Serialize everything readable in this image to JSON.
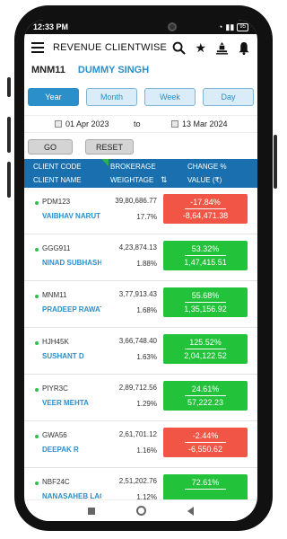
{
  "status_bar": {
    "time": "12:33 PM",
    "battery": "95"
  },
  "app_bar": {
    "title": "REVENUE CLIENTWISE"
  },
  "user": {
    "code": "MNM11",
    "name": "DUMMY SINGH"
  },
  "period_tabs": [
    {
      "label": "Year",
      "active": true
    },
    {
      "label": "Month",
      "active": false
    },
    {
      "label": "Week",
      "active": false
    },
    {
      "label": "Day",
      "active": false
    }
  ],
  "dates": {
    "from": "01 Apr 2023",
    "to_label": "to",
    "to": "13 Mar 2024"
  },
  "buttons": {
    "go": "GO",
    "reset": "RESET"
  },
  "table_header": {
    "client_code": "CLIENT CODE",
    "client_name": "CLIENT NAME",
    "brokerage": "BROKERAGE",
    "weightage": "WEIGHTAGE",
    "sort_icon": "⇅",
    "change_pct": "CHANGE %",
    "value": "VALUE (₹)"
  },
  "rows": [
    {
      "code": "PDM123",
      "name": "VAIBHAV NARUT",
      "brokerage": "39,80,686.77",
      "weightage": "17.7%",
      "change": "-17.84%",
      "value": "-8,64,471.38",
      "trend": "down"
    },
    {
      "code": "GGG911",
      "name": "NINAD SUBHASH AT",
      "brokerage": "4,23,874.13",
      "weightage": "1.88%",
      "change": "53.32%",
      "value": "1,47,415.51",
      "trend": "up"
    },
    {
      "code": "MNM11",
      "name": "PRADEEP RAWAT",
      "brokerage": "3,77,913.43",
      "weightage": "1.68%",
      "change": "55.68%",
      "value": "1,35,156.92",
      "trend": "up"
    },
    {
      "code": "HJH45K",
      "name": "SUSHANT D",
      "brokerage": "3,66,748.40",
      "weightage": "1.63%",
      "change": "125.52%",
      "value": "2,04,122.52",
      "trend": "up"
    },
    {
      "code": "PIYR3C",
      "name": "VEER MEHTA",
      "brokerage": "2,89,712.56",
      "weightage": "1.29%",
      "change": "24.61%",
      "value": "57,222.23",
      "trend": "up"
    },
    {
      "code": "GWA56",
      "name": "DEEPAK R",
      "brokerage": "2,61,701.12",
      "weightage": "1.16%",
      "change": "-2.44%",
      "value": "-6,550.62",
      "trend": "down"
    },
    {
      "code": "NBF24C",
      "name": "NANASAHEB LAGADE",
      "brokerage": "2,51,202.76",
      "weightage": "1.12%",
      "change": "72.61%",
      "value": "",
      "trend": "up"
    }
  ],
  "colors": {
    "accent": "#2b8fc9",
    "header": "#1a6fae",
    "up": "#22c23a",
    "down": "#f05545"
  }
}
